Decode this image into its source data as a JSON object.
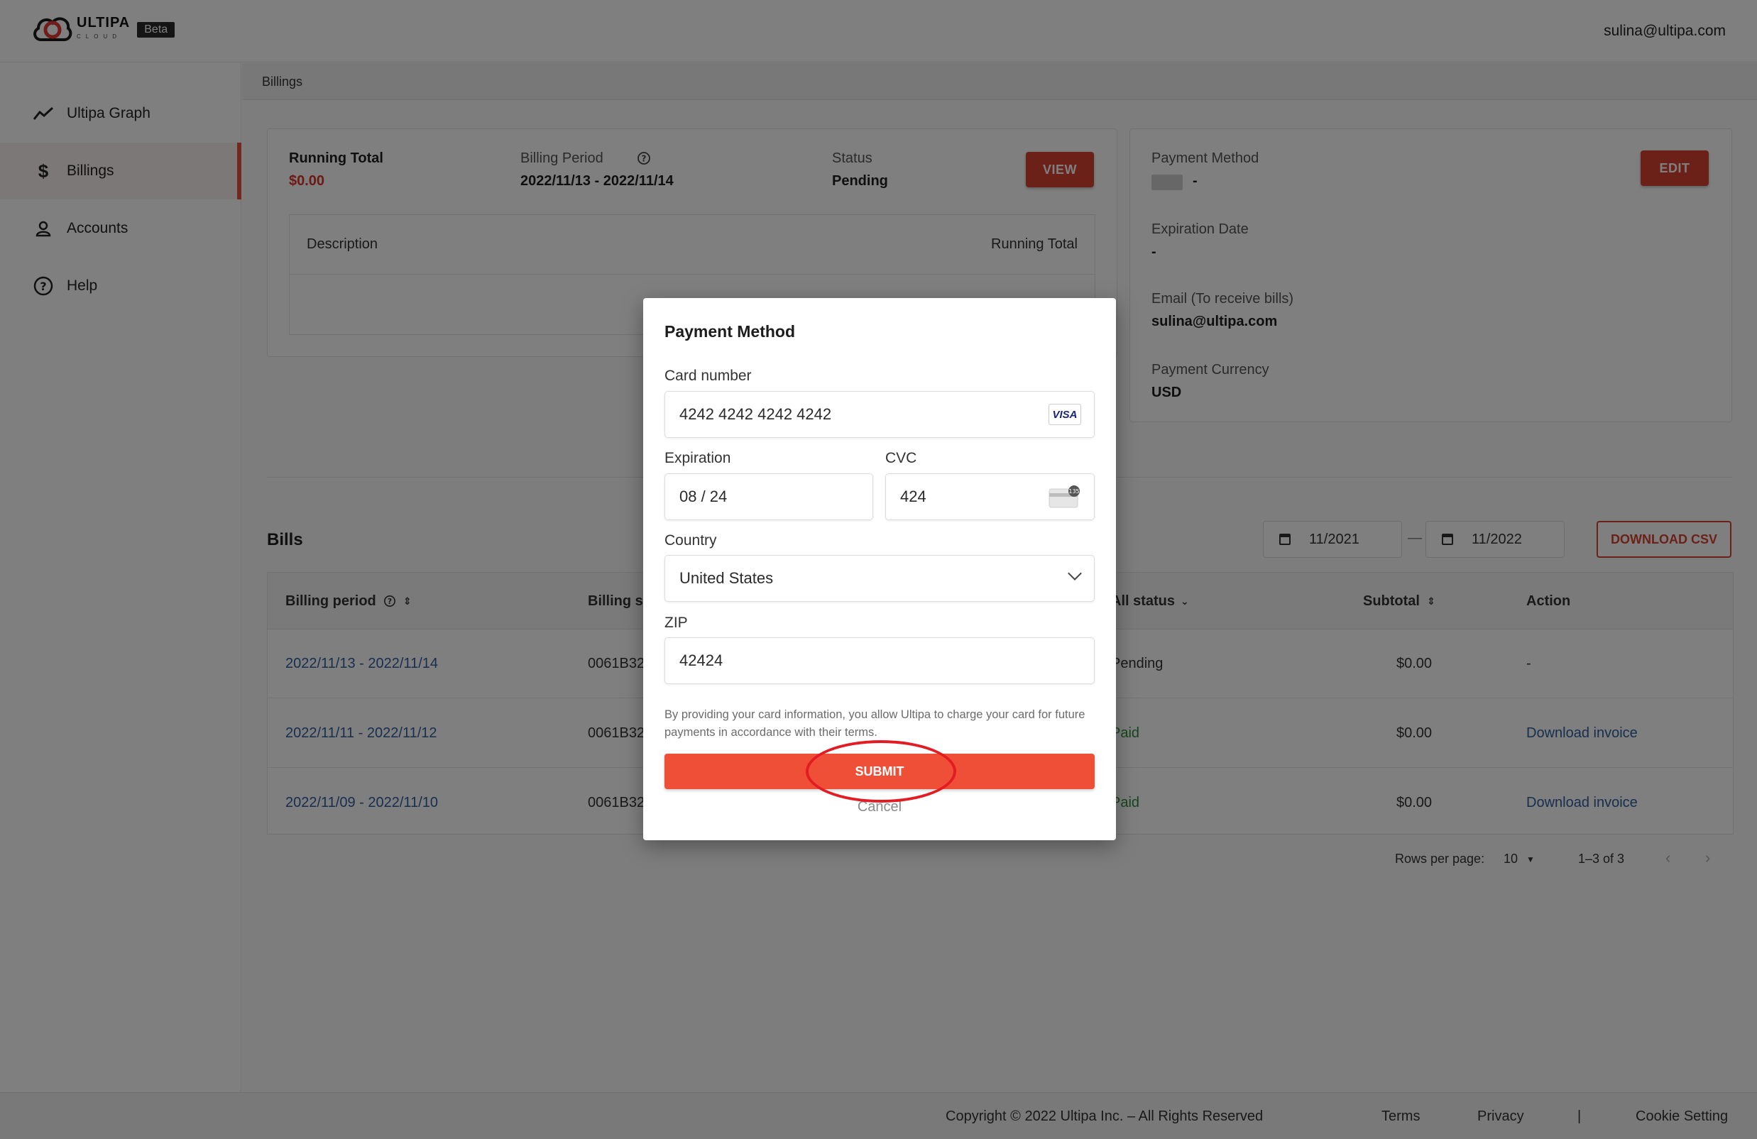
{
  "header": {
    "logo_text": "ULTIPA",
    "logo_sub": "CLOUD",
    "beta": "Beta",
    "user_email": "sulina@ultipa.com"
  },
  "sidebar": {
    "items": [
      {
        "label": "Ultipa Graph",
        "icon": "trend-icon"
      },
      {
        "label": "Billings",
        "icon": "dollar-icon",
        "active": true
      },
      {
        "label": "Accounts",
        "icon": "user-icon"
      },
      {
        "label": "Help",
        "icon": "help-circle-icon"
      }
    ]
  },
  "breadcrumb": "Billings",
  "summary": {
    "running_total_label": "Running Total",
    "running_total_value": "$0.00",
    "billing_period_label": "Billing Period",
    "billing_period_value": "2022/11/13 - 2022/11/14",
    "status_label": "Status",
    "status_value": "Pending",
    "view_button": "VIEW",
    "table_description": "Description",
    "table_running_total": "Running Total"
  },
  "payment_panel": {
    "method_label": "Payment Method",
    "method_value": "-",
    "edit_button": "EDIT",
    "expiration_label": "Expiration Date",
    "expiration_value": "-",
    "email_label": "Email (To receive bills)",
    "email_value": "sulina@ultipa.com",
    "currency_label": "Payment Currency",
    "currency_value": "USD"
  },
  "bills": {
    "title": "Bills",
    "date_from": "11/2021",
    "date_sep": "—",
    "date_to": "11/2022",
    "download_csv": "DOWNLOAD CSV",
    "columns": {
      "period": "Billing period",
      "serial": "Billing se",
      "status": "All status",
      "subtotal": "Subtotal",
      "action": "Action"
    },
    "rows": [
      {
        "period": "2022/11/13 - 2022/11/14",
        "serial": "0061B32",
        "status": "Pending",
        "subtotal": "$0.00",
        "action": "-"
      },
      {
        "period": "2022/11/11 - 2022/11/12",
        "serial": "0061B32",
        "status": "Paid",
        "subtotal": "$0.00",
        "action": "Download invoice"
      },
      {
        "period": "2022/11/09 - 2022/11/10",
        "serial": "0061B32",
        "status": "Paid",
        "subtotal": "$0.00",
        "action": "Download invoice"
      }
    ],
    "rows_per_page_label": "Rows per page:",
    "rows_per_page_value": "10",
    "range": "1–3 of 3"
  },
  "footer": {
    "copyright": "Copyright © 2022 Ultipa Inc. – All Rights Reserved",
    "terms": "Terms",
    "privacy": "Privacy",
    "divider": "|",
    "cookie": "Cookie Setting"
  },
  "modal": {
    "title": "Payment Method",
    "card_label": "Card number",
    "card_value": "4242 4242 4242 4242",
    "card_brand": "VISA",
    "exp_label": "Expiration",
    "exp_value": "08 / 24",
    "cvc_label": "CVC",
    "cvc_value": "424",
    "cvc_badge": "135",
    "country_label": "Country",
    "country_value": "United States",
    "zip_label": "ZIP",
    "zip_value": "42424",
    "terms_text": "By providing your card information, you allow Ultipa to charge your card for future payments in accordance with their terms.",
    "submit": "SUBMIT",
    "cancel": "Cancel"
  },
  "colors": {
    "accent": "#ef4f37",
    "brand_red": "#d7432f",
    "link": "#2f5e9e",
    "paid": "#2e8b3a",
    "highlight": "#e31b23"
  }
}
